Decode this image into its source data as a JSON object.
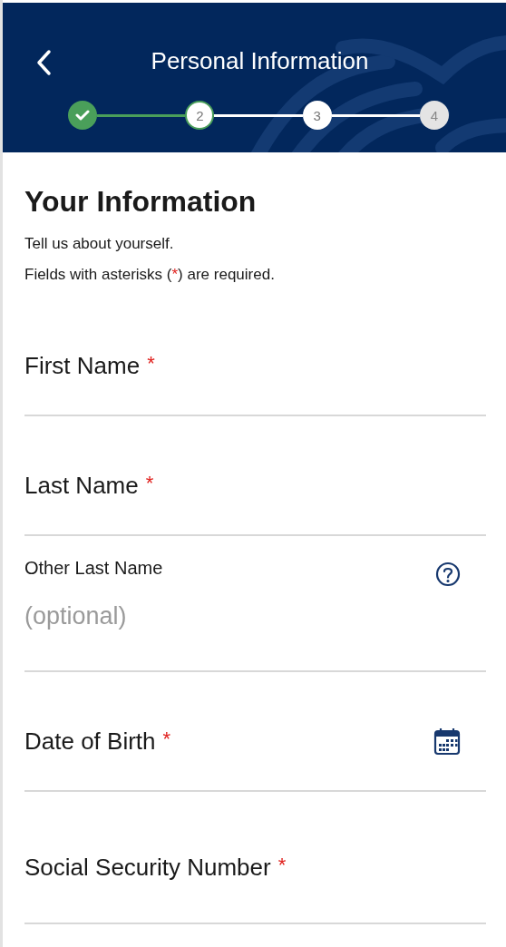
{
  "header": {
    "title": "Personal Information"
  },
  "steps": [
    {
      "kind": "complete"
    },
    {
      "label": "2",
      "kind": "current"
    },
    {
      "label": "3",
      "kind": "upcoming"
    },
    {
      "label": "4",
      "kind": "locked"
    }
  ],
  "section": {
    "title": "Your Information",
    "intro": "Tell us about yourself.",
    "note": {
      "before": "Fields with asterisks (",
      "mark": "*",
      "after": ") are required."
    }
  },
  "fields": [
    {
      "label": "First Name",
      "marker": "*",
      "kind": "text"
    },
    {
      "label": "Last Name",
      "marker": "*",
      "kind": "text"
    },
    {
      "label": "Other Last Name",
      "placeholder": "(optional)",
      "kind": "help"
    },
    {
      "label": "Date of Birth",
      "marker": "*",
      "kind": "date"
    },
    {
      "label": "Social Security Number",
      "marker": "*",
      "kind": "text"
    }
  ]
}
